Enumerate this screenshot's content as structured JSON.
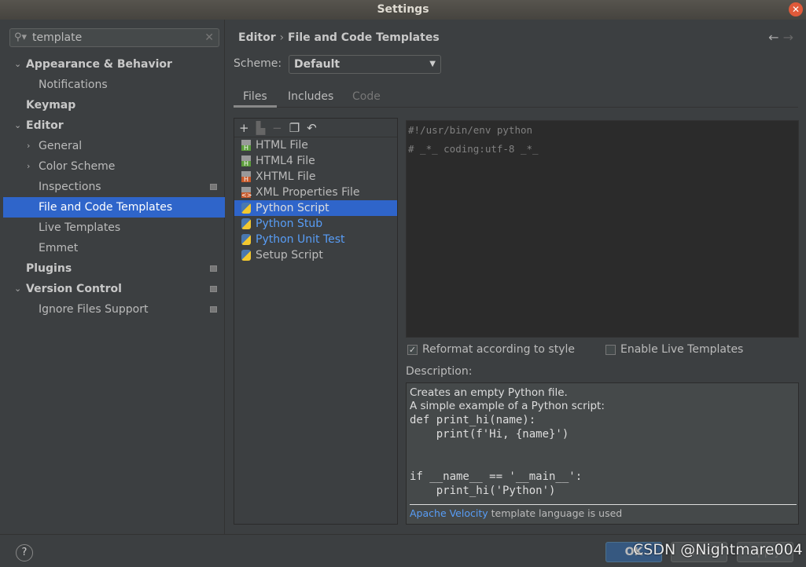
{
  "window": {
    "title": "Settings"
  },
  "search": {
    "value": "template"
  },
  "tree": [
    {
      "label": "Appearance & Behavior",
      "level": 0,
      "bold": true,
      "expanded": true
    },
    {
      "label": "Notifications",
      "level": 1
    },
    {
      "label": "Keymap",
      "level": 0,
      "bold": true
    },
    {
      "label": "Editor",
      "level": 0,
      "bold": true,
      "expanded": true
    },
    {
      "label": "General",
      "level": 1,
      "collapsed": true
    },
    {
      "label": "Color Scheme",
      "level": 1,
      "collapsed": true
    },
    {
      "label": "Inspections",
      "level": 1,
      "badge": true
    },
    {
      "label": "File and Code Templates",
      "level": 1,
      "selected": true
    },
    {
      "label": "Live Templates",
      "level": 1
    },
    {
      "label": "Emmet",
      "level": 1
    },
    {
      "label": "Plugins",
      "level": 0,
      "bold": true,
      "badge": true
    },
    {
      "label": "Version Control",
      "level": 0,
      "bold": true,
      "expanded": true,
      "badge": true
    },
    {
      "label": "Ignore Files Support",
      "level": 1,
      "badge": true
    }
  ],
  "breadcrumb": {
    "parent": "Editor",
    "sep": "›",
    "current": "File and Code Templates"
  },
  "scheme": {
    "label": "Scheme:",
    "value": "Default"
  },
  "tabs": [
    "Files",
    "Includes",
    "Code"
  ],
  "files": [
    {
      "label": "HTML File",
      "icon": "H",
      "color": "#5c9e3c"
    },
    {
      "label": "HTML4 File",
      "icon": "H",
      "color": "#5c9e3c"
    },
    {
      "label": "XHTML File",
      "icon": "H",
      "color": "#c75a2b"
    },
    {
      "label": "XML Properties File",
      "icon": "<>",
      "color": "#c75a2b"
    },
    {
      "label": "Python Script",
      "icon": "py",
      "selected": true
    },
    {
      "label": "Python Stub",
      "icon": "py",
      "blue": true
    },
    {
      "label": "Python Unit Test",
      "icon": "py",
      "blue": true
    },
    {
      "label": "Setup Script",
      "icon": "py"
    }
  ],
  "editor": {
    "lines": [
      "#!/usr/bin/env python",
      "# _*_ coding:utf-8 _*_"
    ]
  },
  "options": {
    "reformat": "Reformat according to style",
    "reformat_checked": true,
    "live": "Enable Live Templates",
    "live_checked": false
  },
  "description": {
    "label": "Description:",
    "text1": "Creates an empty Python file.",
    "text2": "A simple example of a Python script:",
    "code": "def print_hi(name):\n    print(f'Hi, {name}')\n\n\nif __name__ == '__main__':\n    print_hi('Python')",
    "link": "Apache Velocity",
    "footer": " template language is used"
  },
  "buttons": {
    "help": "?",
    "ok": "OK",
    "cancel": "Cancel",
    "apply": "Apply"
  },
  "watermark": "CSDN @Nightmare004"
}
